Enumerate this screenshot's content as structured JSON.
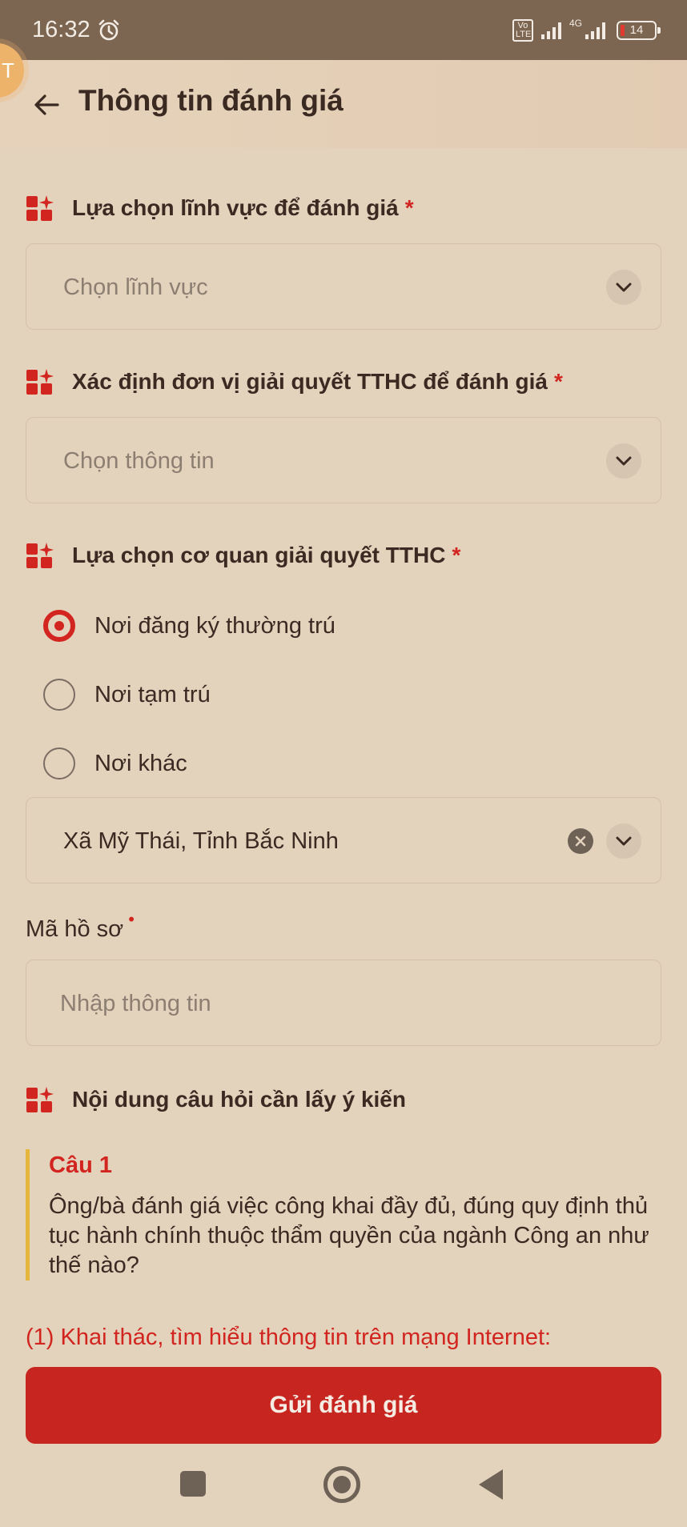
{
  "status_bar": {
    "time": "16:32",
    "volte": "Vo LTE",
    "network": "4G",
    "battery": "14",
    "alarm_icon": "alarm-clock-icon",
    "signal_icon": "signal-bars-icon"
  },
  "header": {
    "title": "Thông tin đánh giá",
    "back_icon": "arrow-left-icon",
    "bubble_text": "T"
  },
  "colors": {
    "accent_red": "#c6261f",
    "background": "#e3d2bc",
    "status_bar": "#7d6651",
    "quote_bar": "#e4b63c"
  },
  "sections": {
    "field": {
      "icon": "grid-sparkle-icon",
      "label": "Lựa chọn lĩnh vực để đánh giá",
      "required_mark": "*",
      "select_placeholder": "Chọn lĩnh vực"
    },
    "unit": {
      "icon": "grid-sparkle-icon",
      "label": "Xác định đơn vị giải quyết TTHC để đánh giá",
      "required_mark": "*",
      "select_placeholder": "Chọn thông tin"
    },
    "agency": {
      "icon": "grid-sparkle-icon",
      "label": "Lựa chọn cơ quan giải quyết TTHC",
      "required_mark": "*",
      "options": [
        {
          "label": "Nơi đăng ký thường trú",
          "checked": true
        },
        {
          "label": "Nơi tạm trú",
          "checked": false
        },
        {
          "label": "Nơi khác",
          "checked": false
        }
      ],
      "selected_location": "Xã Mỹ Thái, Tỉnh Bắc Ninh"
    },
    "record_code": {
      "label": "Mã hồ sơ",
      "required_mark": "•",
      "placeholder": "Nhập thông tin"
    },
    "questions": {
      "icon": "grid-sparkle-icon",
      "label": "Nội dung câu hỏi cần lấy ý kiến",
      "items": [
        {
          "number": "Câu 1",
          "text": "Ông/bà đánh giá việc công khai đầy đủ, đúng quy định thủ tục hành chính thuộc thẩm quyền của ngành Công an như thế nào?"
        }
      ],
      "answer_hint": "(1) Khai thác, tìm hiểu thông tin trên mạng Internet:"
    }
  },
  "submit_label": "Gửi đánh giá",
  "nav_bar": {
    "recent_icon": "square-recents-icon",
    "home_icon": "circle-home-icon",
    "back_icon": "triangle-back-icon"
  }
}
